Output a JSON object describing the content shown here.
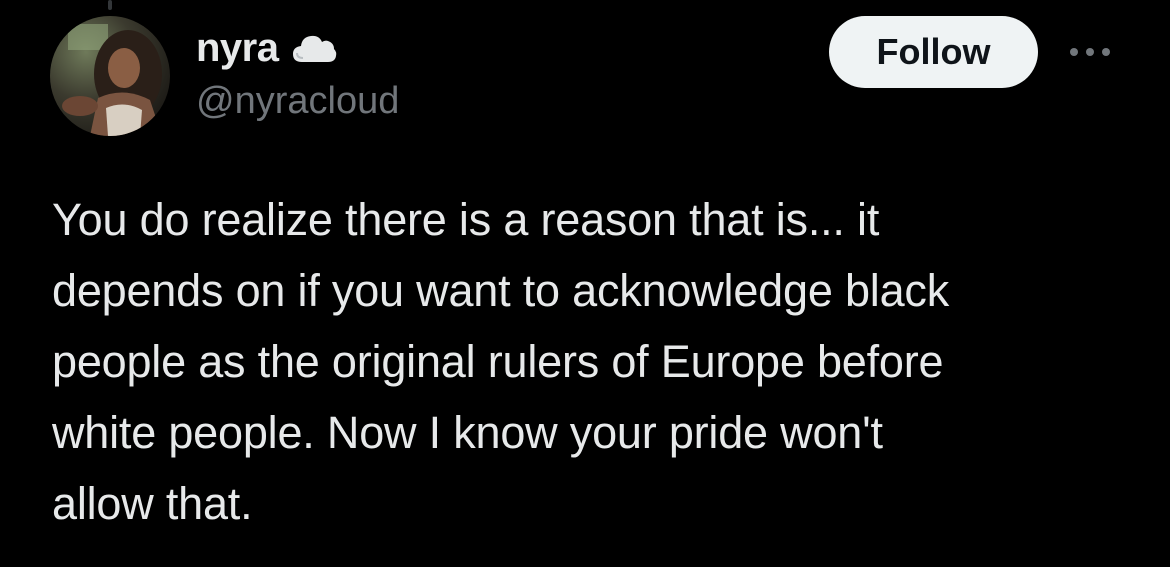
{
  "author": {
    "display_name": "nyra",
    "handle": "@nyracloud",
    "name_emoji_icon": "cloud-icon",
    "avatar_icon": "profile-photo"
  },
  "actions": {
    "follow_label": "Follow",
    "more_icon": "more-options-icon"
  },
  "tweet": {
    "lines": [
      "You do realize there is a reason that is... it",
      "depends on if you want to acknowledge black",
      "people as the original rulers of Europe before",
      "white people. Now I know your pride won't",
      "allow that."
    ]
  },
  "colors": {
    "background": "#000000",
    "primary_text": "#e7e9ea",
    "secondary_text": "#71767b",
    "follow_bg": "#eff3f4",
    "follow_text": "#0f1419"
  }
}
